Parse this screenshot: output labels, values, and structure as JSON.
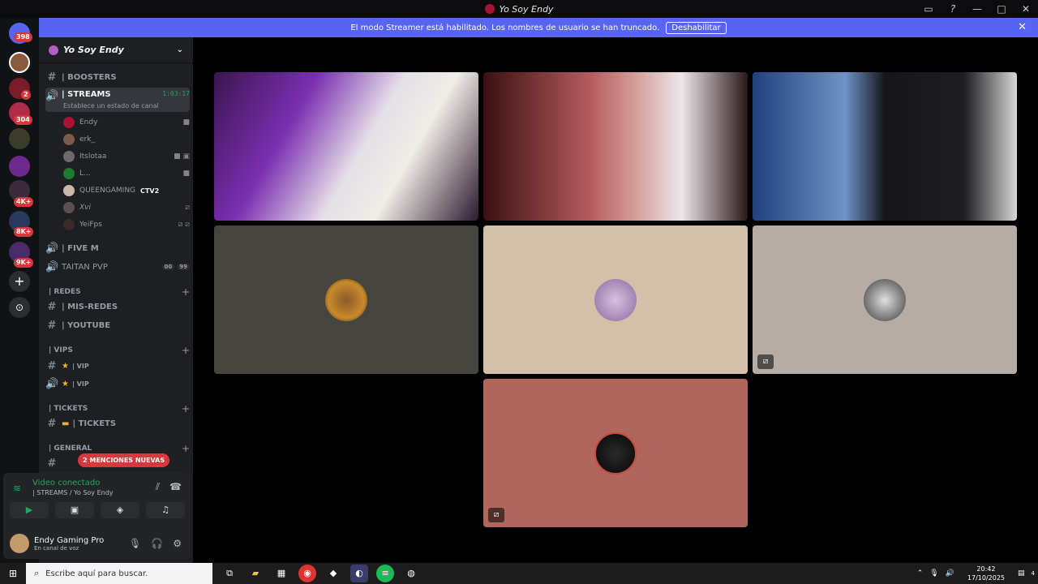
{
  "window": {
    "title": "Yo Soy Endy"
  },
  "banner": {
    "message": "El modo Streamer está habilitado. Los nombres de usuario se han truncado.",
    "button": "Deshabilitar"
  },
  "server_badges": [
    "398",
    "2",
    "304",
    "4K+",
    "8K+",
    "9K+"
  ],
  "sidebar": {
    "guild_name": "Yo Soy Endy",
    "channels": {
      "boosters": "| BOOSTERS",
      "streams": "| STREAMS",
      "streams_timer": "1:03:17",
      "streams_status": "Establece un estado de canal",
      "five_m": "| FIVE M",
      "taitan": "TAITAN PVP",
      "taitan_badges": [
        "00",
        "99"
      ],
      "mis_redes": "| MIS-REDES",
      "youtube": "| YOUTUBE",
      "vip1": "| VIP",
      "vip2": "| VIP",
      "tickets": "| TICKETS"
    },
    "voice_users": [
      "Endy",
      "erk_",
      "Itslotaa",
      "L...",
      "QUEENGAMING",
      "Xvi",
      "YeiFps"
    ],
    "queen_tag": "CTV2",
    "categories": {
      "redes": "| REDES",
      "vips": "| VIPS",
      "tickets": "| TICKETS",
      "general": "| GENERAL"
    },
    "mentions": "2 MENCIONES NUEVAS"
  },
  "voice": {
    "status": "Video conectado",
    "channel": "| STREAMS / Yo Soy Endy"
  },
  "user": {
    "name": "Endy Gaming Pro",
    "status": "En canal de voz"
  },
  "taskbar": {
    "search_placeholder": "Escribe aquí para buscar.",
    "time": "20:42",
    "date": "17/10/2025",
    "notif_count": "4"
  },
  "colors": {
    "accent": "#5865f2",
    "online": "#23a55a",
    "danger": "#da373c"
  }
}
